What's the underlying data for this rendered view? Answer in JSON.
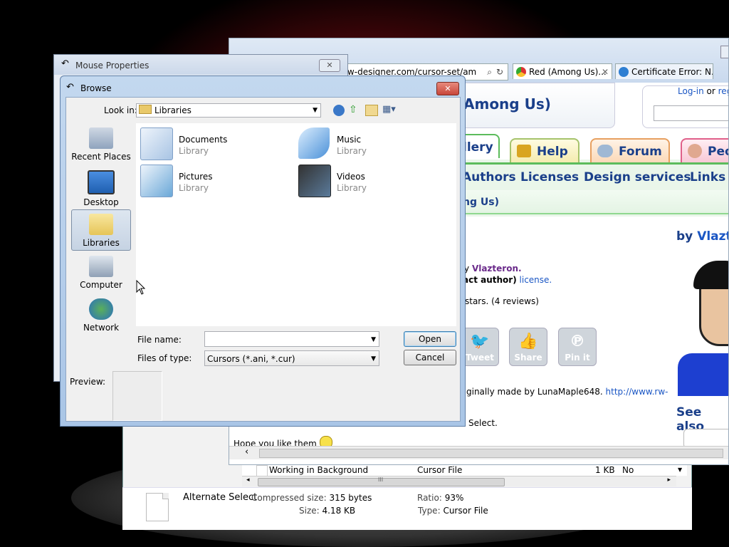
{
  "explorer": {
    "row": {
      "name": "Working in Background",
      "type": "Cursor File",
      "size": "1 KB",
      "flag": "No"
    },
    "details": {
      "filename": "Alternate Select",
      "compressed_label": "Compressed size:",
      "compressed_value": "315 bytes",
      "size_label": "Size:",
      "size_value": "4.18 KB",
      "ratio_label": "Ratio:",
      "ratio_value": "93%",
      "type_label": "Type:",
      "type_value": "Cursor File"
    },
    "scroll_glyph": "III"
  },
  "browser": {
    "address": "rw-designer.com/cursor-set/am",
    "tabs": [
      {
        "label": "Red (Among Us)...",
        "close": "✕"
      },
      {
        "label": "Certificate Error: N..."
      }
    ],
    "page": {
      "title_fragment": "Among Us)",
      "login": "Log-in",
      "or": "or",
      "register": "regi",
      "nav_tabs": [
        "llery",
        "Help",
        "Forum",
        "Peo"
      ],
      "nav_links": [
        "Authors",
        "Licenses",
        "Design services",
        "Links"
      ],
      "breadcrumb": "ng Us)",
      "by": "by",
      "author": "Vlazte",
      "line_author_prefix": "y",
      "line_author": "Vlazteron.",
      "line_license_bold": "act author)",
      "line_license_link": "license.",
      "rating": "stars. (4 reviews)",
      "social": [
        "Tweet",
        "Share",
        "Pin it"
      ],
      "origin_text": "ginally  made  by  LunaMaple648.",
      "origin_link": "http://www.rw-",
      "select_text": "Select.",
      "see_also": "See also",
      "hope": "Hope you like them"
    }
  },
  "mouse_properties": {
    "title": "Mouse Properties",
    "close": "✕"
  },
  "browse": {
    "title": "Browse",
    "close": "✕",
    "look_in_label": "Look in:",
    "look_in_value": "Libraries",
    "places": [
      "Recent Places",
      "Desktop",
      "Libraries",
      "Computer",
      "Network"
    ],
    "items": [
      {
        "name": "Documents",
        "sub": "Library"
      },
      {
        "name": "Music",
        "sub": "Library"
      },
      {
        "name": "Pictures",
        "sub": "Library"
      },
      {
        "name": "Videos",
        "sub": "Library"
      }
    ],
    "file_name_label": "File name:",
    "file_name_value": "",
    "files_of_type_label": "Files of type:",
    "files_of_type_value": "Cursors (*.ani, *.cur)",
    "open": "Open",
    "cancel": "Cancel",
    "preview_label": "Preview:"
  },
  "colors": {
    "accent": "#1a3f8a",
    "dialog_frame": "#a9c5e6",
    "close_red": "#c7463a"
  }
}
